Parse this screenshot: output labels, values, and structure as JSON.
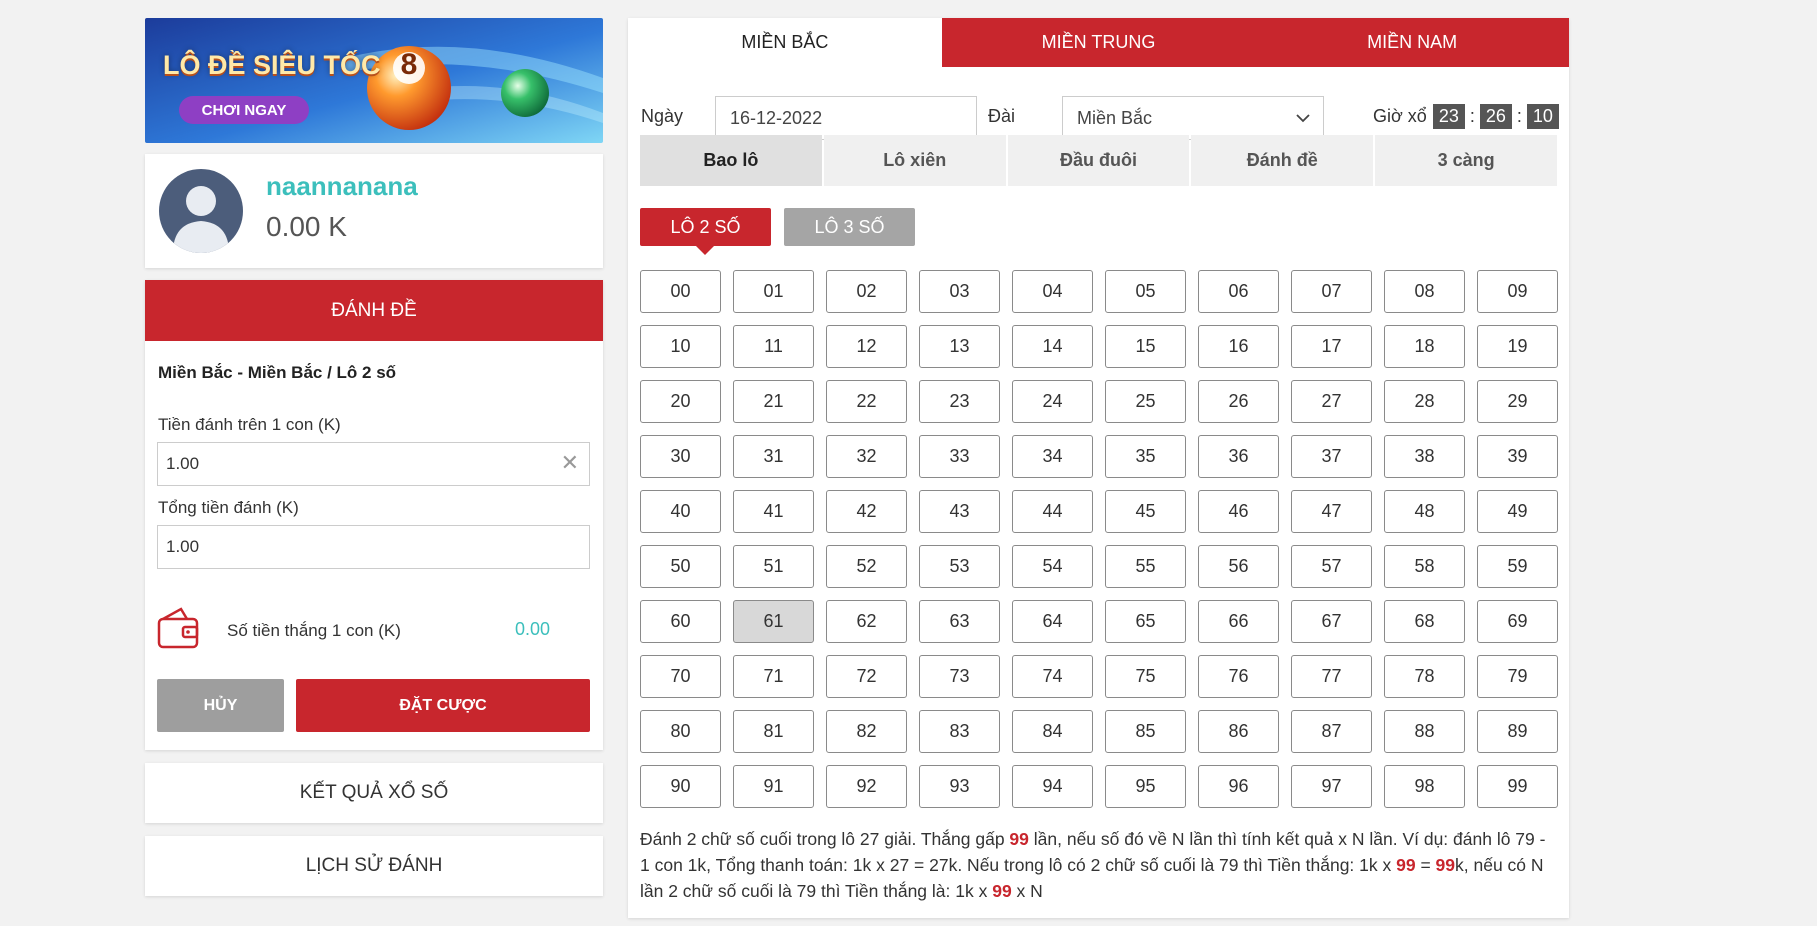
{
  "banner": {
    "title": "LÔ ĐỀ SIÊU TỐC",
    "cta": "CHƠI NGAY",
    "ball_number": "8"
  },
  "profile": {
    "username": "naannanana",
    "balance": "0.00 K"
  },
  "bet_panel": {
    "header": "ĐÁNH ĐỀ",
    "subtitle": "Miền Bắc - Miền Bắc / Lô 2 số",
    "stake_label": "Tiền đánh trên 1 con (K)",
    "stake_value": "1.00",
    "total_label": "Tổng tiền đánh (K)",
    "total_value": "1.00",
    "win_label": "Số tiền thắng 1 con (K)",
    "win_value": "0.00",
    "cancel_label": "HỦY",
    "place_label": "ĐẶT CƯỢC"
  },
  "links": {
    "results": "KẾT QUẢ XỔ SỐ",
    "history": "LỊCH SỬ ĐÁNH"
  },
  "region_tabs": [
    {
      "label": "MIỀN BẮC",
      "active": true
    },
    {
      "label": "MIỀN TRUNG",
      "active": false
    },
    {
      "label": "MIỀN NAM",
      "active": false
    }
  ],
  "filters": {
    "date_label": "Ngày",
    "date_value": "16-12-2022",
    "station_label": "Đài",
    "station_value": "Miền Bắc",
    "draw_label": "Giờ xổ",
    "hh": "23",
    "mm": "26",
    "ss": "10"
  },
  "bet_tabs": [
    {
      "label": "Bao lô",
      "active": true
    },
    {
      "label": "Lô xiên",
      "active": false
    },
    {
      "label": "Đầu đuôi",
      "active": false
    },
    {
      "label": "Đánh đề",
      "active": false
    },
    {
      "label": "3 càng",
      "active": false
    }
  ],
  "sub_tabs": [
    {
      "label": "LÔ 2 SỐ",
      "active": true
    },
    {
      "label": "LÔ 3 SỐ",
      "active": false
    }
  ],
  "numbers": {
    "count": 100,
    "selected": [
      "61"
    ]
  },
  "note": {
    "p1": "Đánh 2 chữ số cuối trong lô 27 giải. Thắng gấp ",
    "x1": "99",
    "p2": " lần, nếu số đó về N lần thì tính kết quả x N lần. Ví dụ: đánh lô 79 - 1 con 1k, Tổng thanh toán: 1k x 27 = 27k. Nếu trong lô có 2 chữ số cuối là 79 thì Tiền thắng: 1k x ",
    "x2": "99",
    "p3": " = ",
    "x3": "99",
    "p4": "k, nếu có N lần 2 chữ số cuối là 79 thì Tiền thắng là: 1k x ",
    "x4": "99",
    "p5": " x N"
  },
  "colors": {
    "brand_red": "#c8262d",
    "teal": "#3cbfbc",
    "gray_button": "#9e9e9e"
  }
}
